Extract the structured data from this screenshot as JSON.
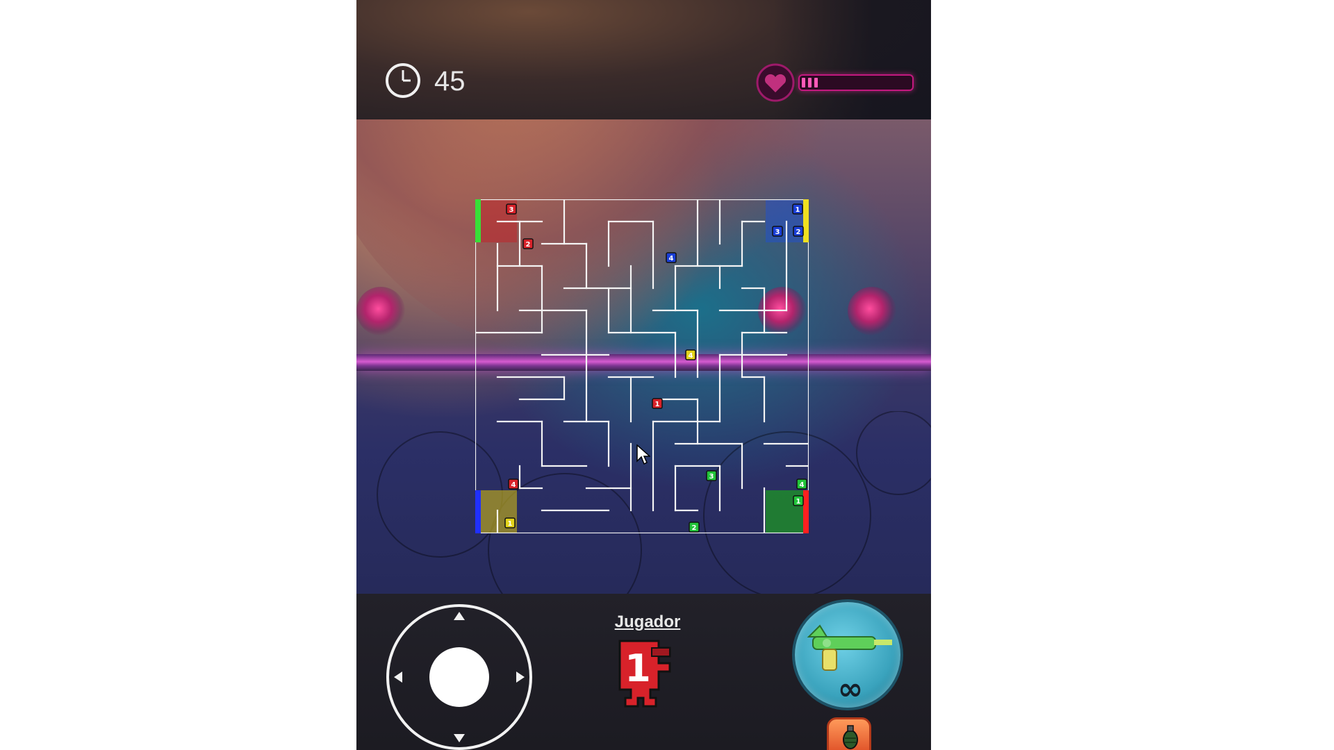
{
  "hud": {
    "timer_icon": "clock-icon",
    "timer_value": "45",
    "health_icon": "heart-icon",
    "health_fraction": 0.12,
    "health_color": "#ff5ab8"
  },
  "maze": {
    "corner_colors": {
      "top_left": "#c0262c",
      "top_right": "#1f4fd0",
      "bottom_left": "#b5a31f",
      "bottom_right": "#1e8a2c"
    },
    "edge_markers": [
      "#38e038",
      "#f0e020",
      "#2030ff",
      "#ff2020"
    ],
    "tokens": [
      {
        "team": "red",
        "label": "3"
      },
      {
        "team": "red",
        "label": "2"
      },
      {
        "team": "red",
        "label": "1"
      },
      {
        "team": "red",
        "label": "4"
      },
      {
        "team": "blue",
        "label": "1"
      },
      {
        "team": "blue",
        "label": "3"
      },
      {
        "team": "blue",
        "label": "2"
      },
      {
        "team": "blue",
        "label": "4"
      },
      {
        "team": "yellow",
        "label": "4"
      },
      {
        "team": "yellow",
        "label": "1"
      },
      {
        "team": "green",
        "label": "3"
      },
      {
        "team": "green",
        "label": "4"
      },
      {
        "team": "green",
        "label": "1"
      },
      {
        "team": "green",
        "label": "2"
      }
    ],
    "team_colors": {
      "red": "#d8222a",
      "blue": "#1a3fd8",
      "yellow": "#e2d21a",
      "green": "#22c43a"
    }
  },
  "controls": {
    "joystick_icon": "joystick-icon",
    "player_label": "Jugador",
    "player_number": "1",
    "player_color": "#d8222a",
    "weapon_icon": "ray-gun-icon",
    "ammo_text": "∞",
    "grenade_icon": "grenade-icon"
  }
}
